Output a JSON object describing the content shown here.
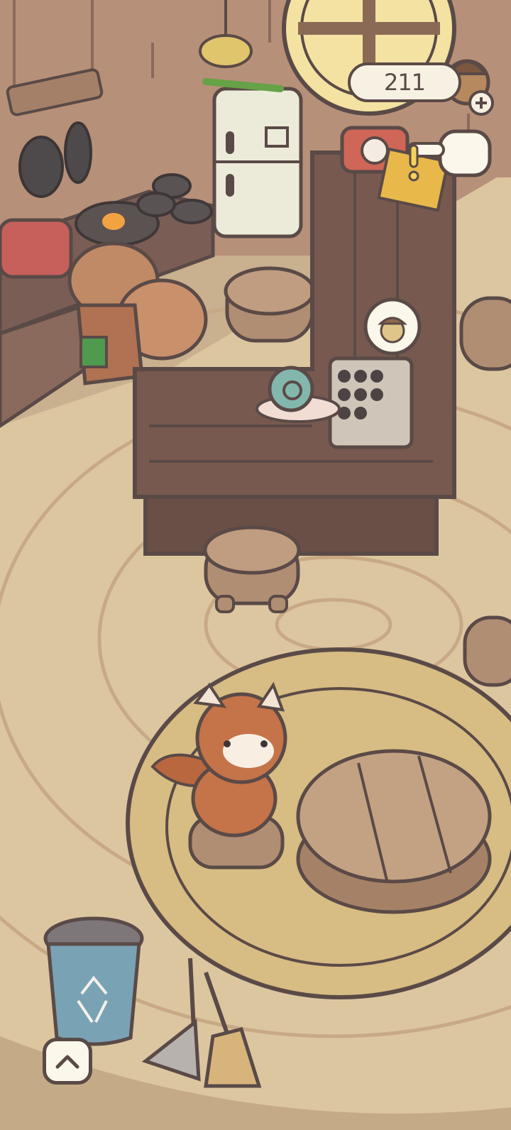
{
  "hud": {
    "acorn_count": "211",
    "acorn_icon": "acorn-icon",
    "add_icon": "plus-icon",
    "scroll_up_icon": "chevron-up-icon"
  },
  "colors": {
    "floor": "#d9c29c",
    "wall": "#b28d76",
    "outline": "#5a4a47",
    "counter": "#7a5e55",
    "rug": "#d7bc83"
  }
}
